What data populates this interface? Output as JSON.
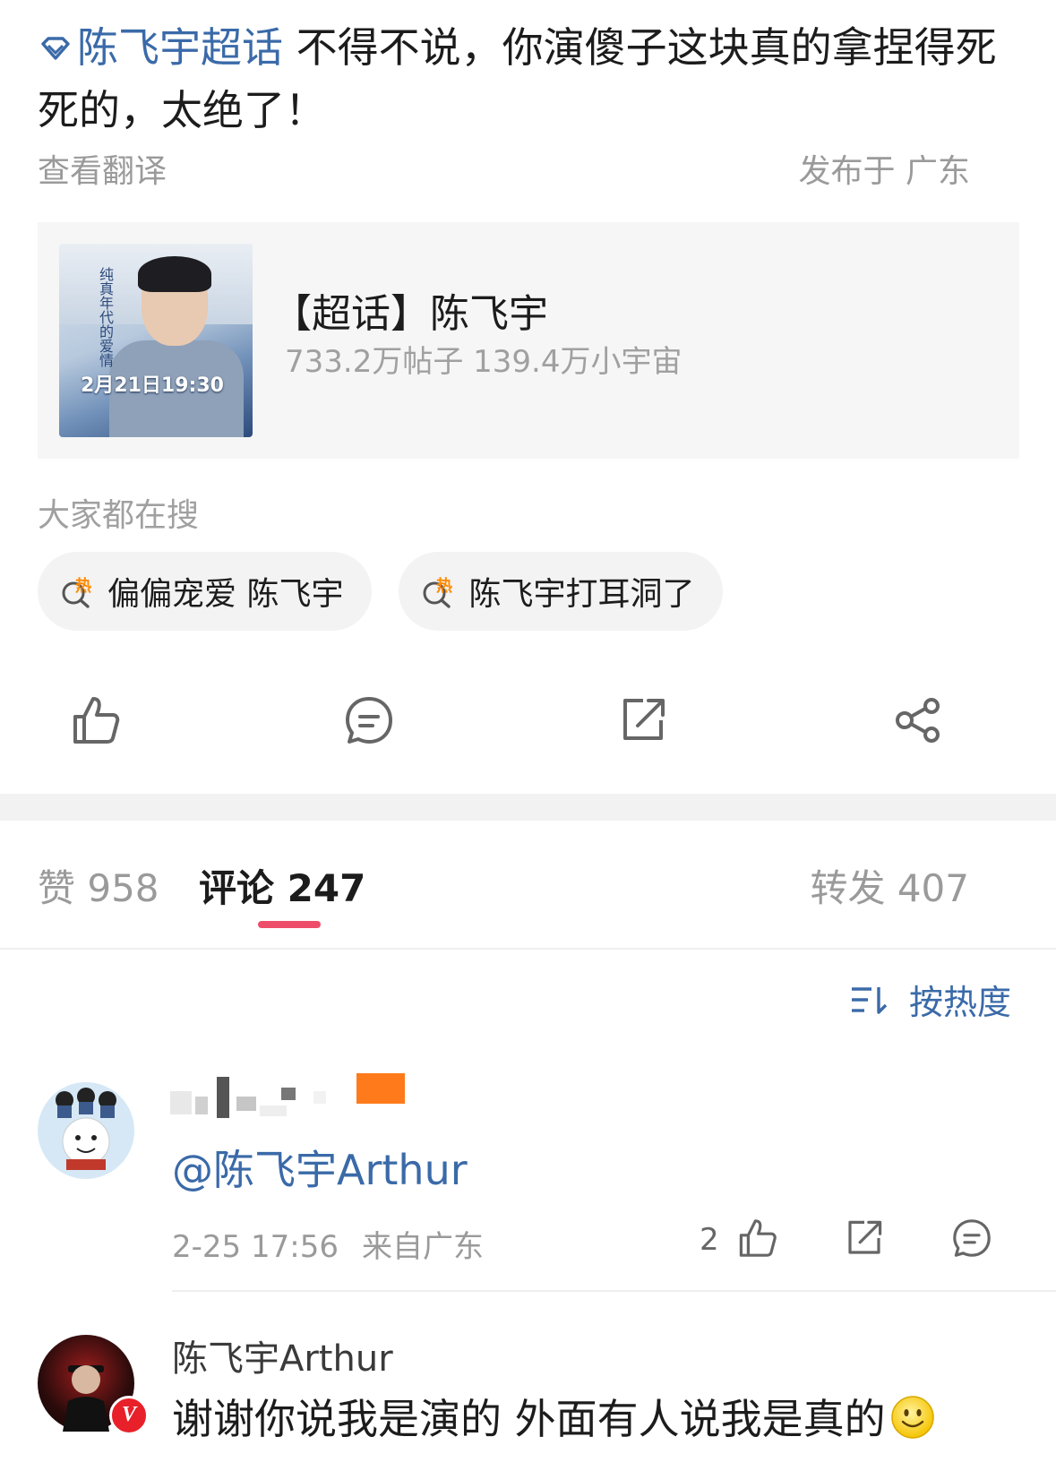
{
  "post": {
    "topic_link": "陈飞宇超话",
    "text": " 不得不说，你演傻子这块真的拿捏得死死的，太绝了！",
    "translate": "查看翻译",
    "location": "发布于 广东"
  },
  "topic_card": {
    "title": "【超话】陈飞宇",
    "stats": "733.2万帖子 139.4万小宇宙",
    "thumb_vertical_text": "纯真年代的爱情",
    "thumb_date": "2月21日19:30"
  },
  "hot_search": {
    "label": "大家都在搜",
    "items": [
      {
        "icon": "hot-search-icon",
        "text": "偏偏宠爱 陈飞宇"
      },
      {
        "icon": "hot-search-icon",
        "text": "陈飞宇打耳洞了"
      }
    ]
  },
  "action_bar": {
    "items": [
      "like-icon",
      "comment-icon",
      "repost-icon",
      "share-icon"
    ]
  },
  "tabs": {
    "like": "赞 958",
    "comment": "评论 247",
    "repost": "转发 407"
  },
  "sort": {
    "label": "按热度",
    "icon": "sort-icon"
  },
  "comments": [
    {
      "mention": "@陈飞宇Arthur",
      "time": "2-25 17:56",
      "from": "来自广东",
      "likes": "2"
    }
  ],
  "reply": {
    "name": "陈飞宇Arthur",
    "text": "谢谢你说我是演的 外面有人说我是真的",
    "badge": "V"
  },
  "colors": {
    "link_blue": "#3a6aa8",
    "accent_pink": "#ee4d6a",
    "hot_orange": "#ff8a00"
  }
}
